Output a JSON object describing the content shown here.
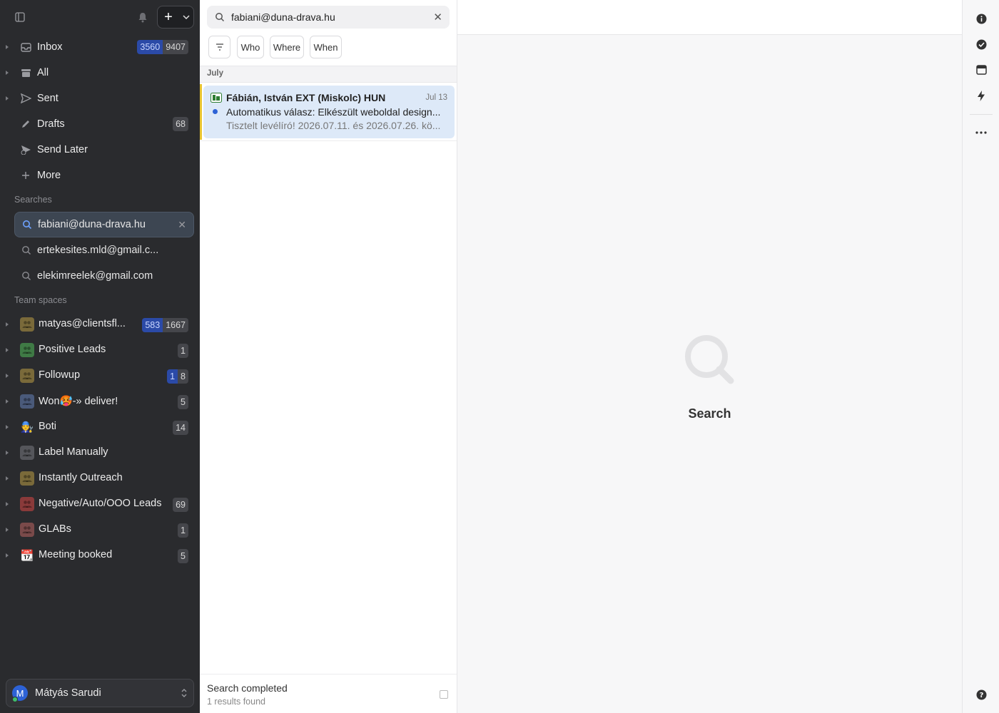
{
  "sidebar": {
    "nav": [
      {
        "label": "Inbox",
        "icon": "inbox-icon",
        "badge_blue": "3560",
        "badge": "9407"
      },
      {
        "label": "All",
        "icon": "archive-icon"
      },
      {
        "label": "Sent",
        "icon": "send-icon"
      },
      {
        "label": "Drafts",
        "icon": "pencil-icon",
        "badge": "68"
      },
      {
        "label": "Send Later",
        "icon": "send-later-icon"
      },
      {
        "label": "More",
        "icon": "plus-icon"
      }
    ],
    "searches_header": "Searches",
    "searches": [
      {
        "label": "fabiani@duna-drava.hu"
      },
      {
        "label": "ertekesites.mld@gmail.c..."
      },
      {
        "label": "elekimreelek@gmail.com"
      }
    ],
    "team_header": "Team spaces",
    "teams": [
      {
        "label": "matyas@clientsfl...",
        "color": "#7a6a3a",
        "badge_blue": "583",
        "badge": "1667"
      },
      {
        "label": "Positive Leads",
        "color": "#3f7a45",
        "badge": "1"
      },
      {
        "label": "Followup",
        "color": "#7a6a3a",
        "badge_blue": "1",
        "badge": "8"
      },
      {
        "label": "Won🥵-» deliver!",
        "color": "#4a5a7a",
        "badge": "5"
      },
      {
        "label": "Boti",
        "emoji": "🧑‍🔧",
        "badge": "14"
      },
      {
        "label": "Label Manually",
        "color": "#55565b"
      },
      {
        "label": "Instantly Outreach",
        "color": "#7a6a3a"
      },
      {
        "label": "Negative/Auto/OOO Leads",
        "color": "#8a3a3a",
        "badge": "69"
      },
      {
        "label": "GLABs",
        "color": "#7a4a4a",
        "badge": "1"
      },
      {
        "label": "Meeting booked",
        "emoji": "📆",
        "badge": "5"
      }
    ],
    "user": {
      "initial": "M",
      "name": "Mátyás Sarudi"
    }
  },
  "list": {
    "search_query": "fabiani@duna-drava.hu",
    "filters": [
      "Who",
      "Where",
      "When"
    ],
    "group": "July",
    "message": {
      "from": "Fábián, István EXT (Miskolc) HUN",
      "date": "Jul 13",
      "subject": "Automatikus válasz: Elkészült weboldal design...",
      "preview": "Tisztelt levélíró! 2026.07.11. és 2026.07.26. kö..."
    },
    "status": "Search completed",
    "status_count": "1 results found"
  },
  "reading": {
    "empty_label": "Search"
  },
  "colors": {
    "sidebar_bg": "#2a2b2e",
    "accent": "#2d62d6",
    "selected_msg": "#dde9f8"
  }
}
